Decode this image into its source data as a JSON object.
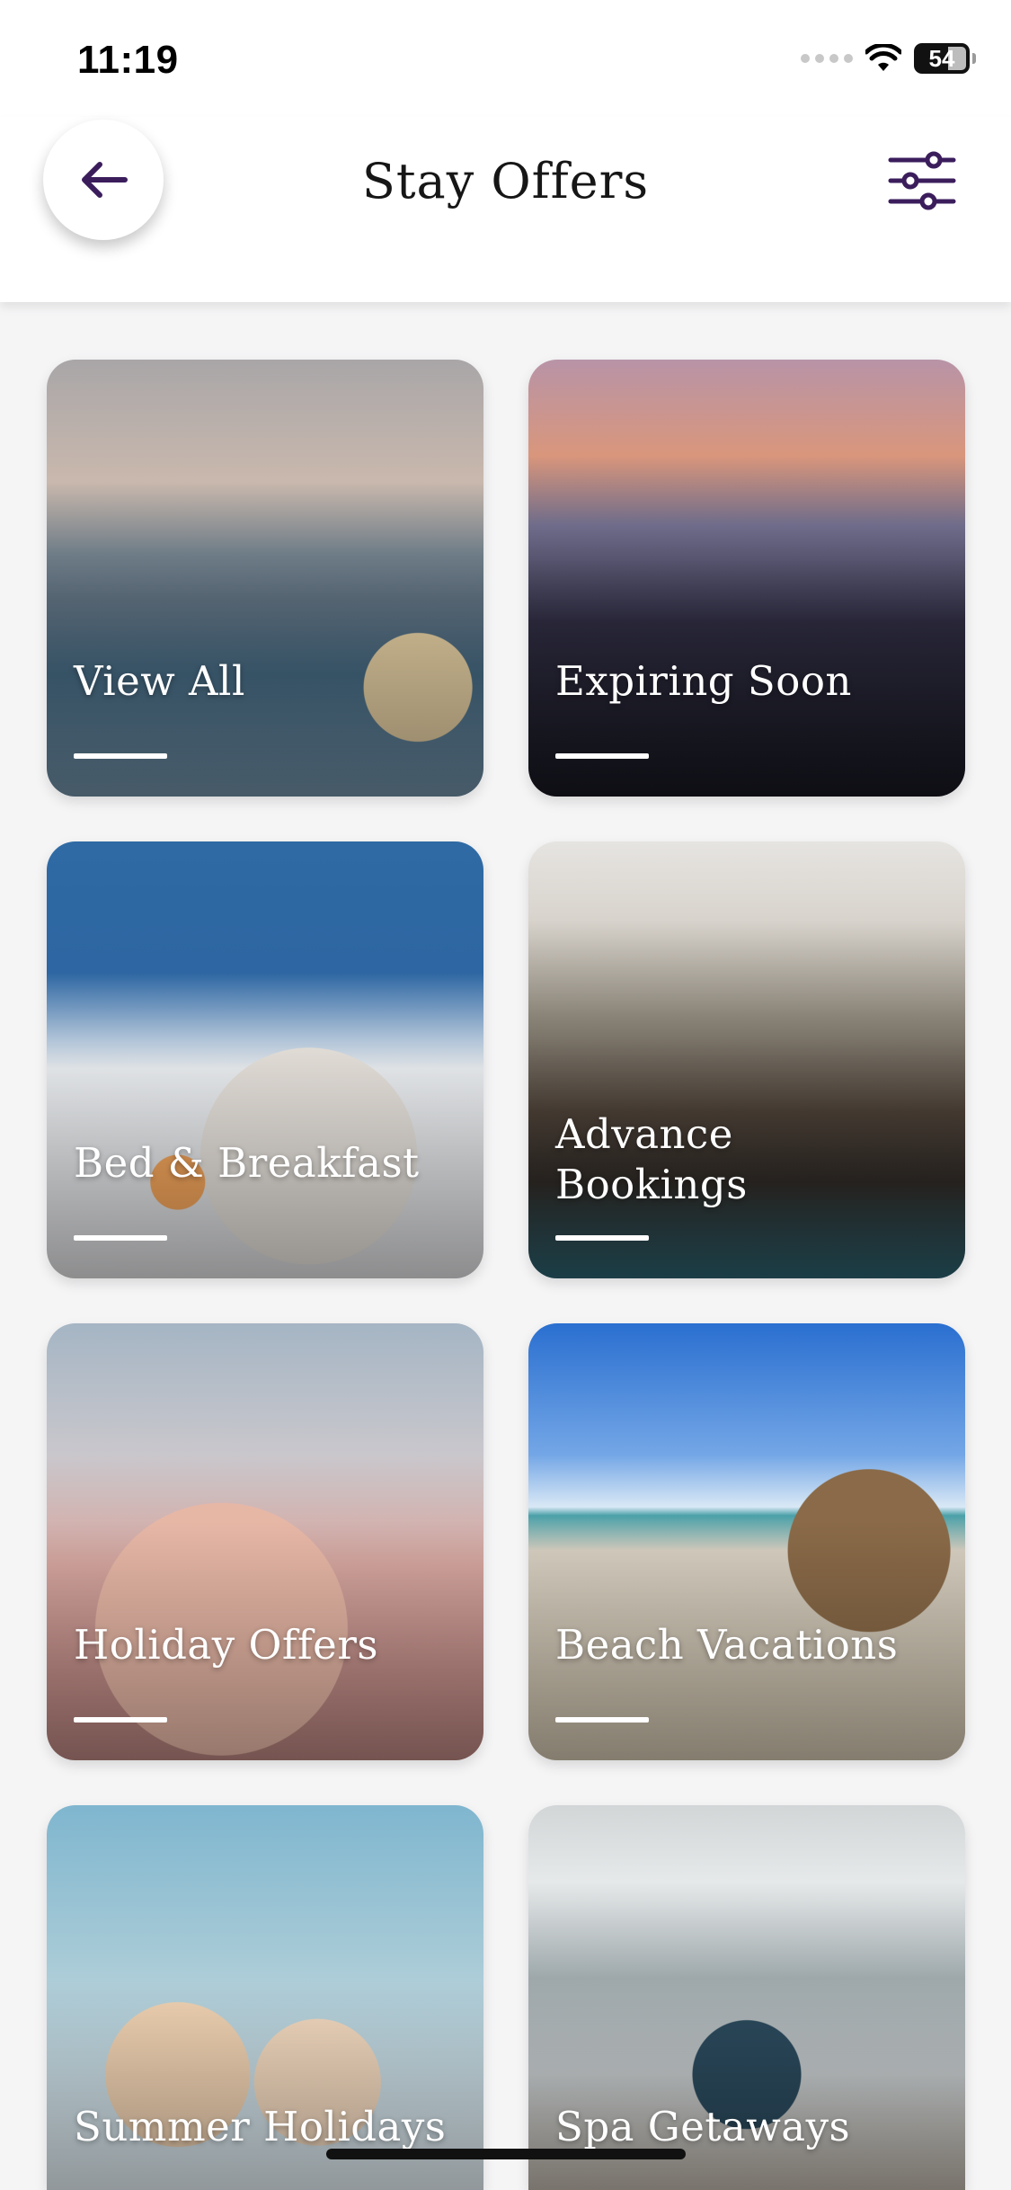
{
  "status_bar": {
    "time": "11:19",
    "battery": "54"
  },
  "header": {
    "title": "Stay Offers",
    "back_icon": "arrow-left-icon",
    "filter_icon": "sliders-icon",
    "accent_color": "#3b1d5c"
  },
  "offers": [
    {
      "label": "View All"
    },
    {
      "label": "Expiring Soon"
    },
    {
      "label": "Bed & Breakfast"
    },
    {
      "label": "Advance Bookings"
    },
    {
      "label": "Holiday Offers"
    },
    {
      "label": "Beach Vacations"
    },
    {
      "label": "Summer Holidays"
    },
    {
      "label": "Spa Getaways"
    }
  ]
}
